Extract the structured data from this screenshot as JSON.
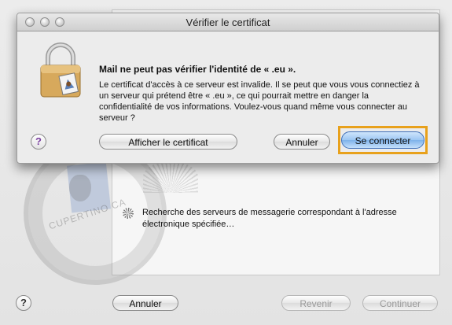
{
  "background_window": {
    "status_text": "Recherche des serveurs de messagerie correspondant à l'adresse électronique spécifiée…",
    "stamp_text": "CUPERTINO CA",
    "help_label": "?",
    "cancel_label": "Annuler",
    "back_label": "Revenir",
    "continue_label": "Continuer"
  },
  "dialog": {
    "title": "Vérifier le certificat",
    "heading": "Mail ne peut pas vérifier l'identité de «           .eu ».",
    "body": "Le certificat d'accès à ce serveur est invalide. Il se peut que vous vous connectiez à un serveur qui prétend être «           .eu », ce qui pourrait mettre en danger la confidentialité de vos informations. Voulez-vous quand même vous connecter au serveur ?",
    "help_label": "?",
    "show_certificate_label": "Afficher le certificat",
    "cancel_label": "Annuler",
    "connect_label": "Se connecter"
  },
  "colors": {
    "focus_highlight": "#e8a11c",
    "default_button": "#7fb2ea",
    "help_icon": "#7a3fa0"
  }
}
